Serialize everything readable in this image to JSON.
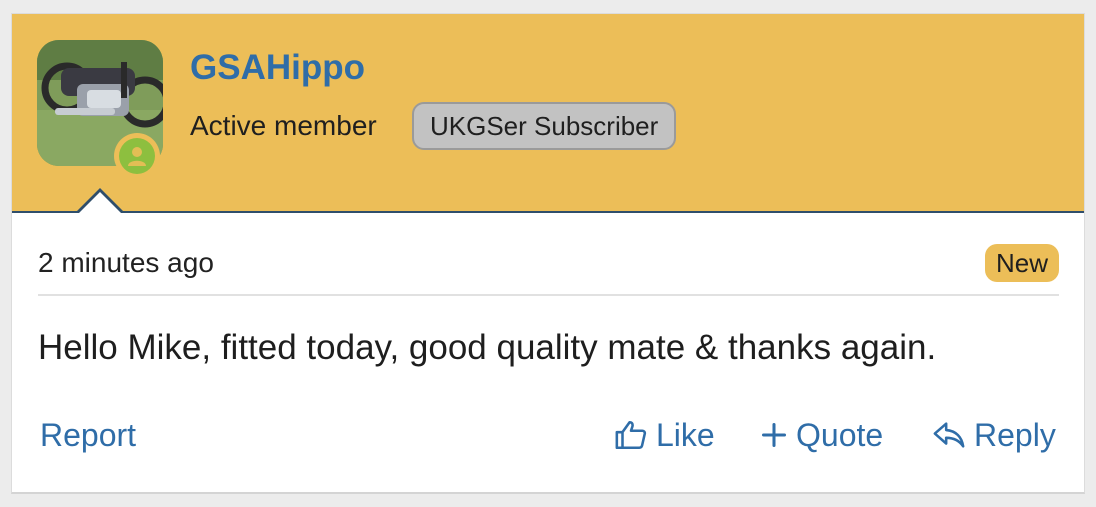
{
  "user": {
    "name": "GSAHippo",
    "title": "Active member",
    "banner": "UKGSer Subscriber",
    "avatar_icon": "motorcycle-avatar",
    "online_icon": "user-online-icon"
  },
  "post": {
    "date": "2 minutes ago",
    "new_badge": "New",
    "message": "Hello Mike, fitted today, good quality mate & thanks again."
  },
  "actions": {
    "report": "Report",
    "like": "Like",
    "quote": "Quote",
    "reply": "Reply"
  },
  "colors": {
    "header_bg": "#ecbe58",
    "link": "#2f6da8",
    "online": "#8dbf3f"
  }
}
